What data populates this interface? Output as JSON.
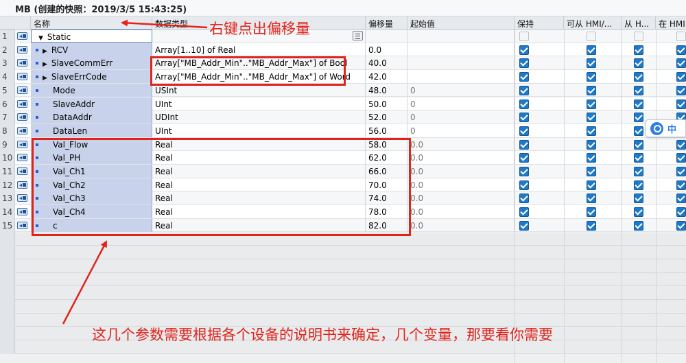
{
  "window": {
    "title": "MB (创建的快照：2019/3/5 15:43:25)"
  },
  "columns": {
    "name": "名称",
    "datatype": "数据类型",
    "offset": "偏移量",
    "start": "起始值",
    "retain": "保持",
    "hmi_access": "可从 HMI/...",
    "hmi_from": "从 H...",
    "hmi_in": "在 HMI"
  },
  "rows": [
    {
      "num": "1",
      "name": "Static",
      "datatype": "",
      "offset": "",
      "start": "",
      "expand": "▼",
      "level": 0,
      "checks": [
        false,
        false,
        false,
        false
      ]
    },
    {
      "num": "2",
      "name": "RCV",
      "datatype": "Array[1..10] of Real",
      "offset": "0.0",
      "start": "",
      "expand": "▶",
      "level": 1,
      "checks": [
        true,
        true,
        true,
        true
      ]
    },
    {
      "num": "3",
      "name": "SlaveCommErr",
      "datatype": "Array[\"MB_Addr_Min\"..\"MB_Addr_Max\"] of Bool",
      "offset": "40.0",
      "start": "",
      "expand": "▶",
      "level": 1,
      "checks": [
        true,
        true,
        true,
        true
      ]
    },
    {
      "num": "4",
      "name": "SlaveErrCode",
      "datatype": "Array[\"MB_Addr_Min\"..\"MB_Addr_Max\"] of Word",
      "offset": "42.0",
      "start": "",
      "expand": "▶",
      "level": 1,
      "checks": [
        true,
        true,
        true,
        true
      ]
    },
    {
      "num": "5",
      "name": "Mode",
      "datatype": "USInt",
      "offset": "48.0",
      "start": "0",
      "expand": "",
      "level": 1,
      "checks": [
        true,
        true,
        true,
        true
      ]
    },
    {
      "num": "6",
      "name": "SlaveAddr",
      "datatype": "UInt",
      "offset": "50.0",
      "start": "0",
      "expand": "",
      "level": 1,
      "checks": [
        true,
        true,
        true,
        true
      ]
    },
    {
      "num": "7",
      "name": "DataAddr",
      "datatype": "UDInt",
      "offset": "52.0",
      "start": "0",
      "expand": "",
      "level": 1,
      "checks": [
        true,
        true,
        true,
        true
      ]
    },
    {
      "num": "8",
      "name": "DataLen",
      "datatype": "UInt",
      "offset": "56.0",
      "start": "0",
      "expand": "",
      "level": 1,
      "checks": [
        true,
        true,
        true,
        true
      ]
    },
    {
      "num": "9",
      "name": "Val_Flow",
      "datatype": "Real",
      "offset": "58.0",
      "start": "0.0",
      "expand": "",
      "level": 1,
      "checks": [
        true,
        true,
        true,
        true
      ]
    },
    {
      "num": "10",
      "name": "Val_PH",
      "datatype": "Real",
      "offset": "62.0",
      "start": "0.0",
      "expand": "",
      "level": 1,
      "checks": [
        true,
        true,
        true,
        true
      ]
    },
    {
      "num": "11",
      "name": "Val_Ch1",
      "datatype": "Real",
      "offset": "66.0",
      "start": "0.0",
      "expand": "",
      "level": 1,
      "checks": [
        true,
        true,
        true,
        true
      ]
    },
    {
      "num": "12",
      "name": "Val_Ch2",
      "datatype": "Real",
      "offset": "70.0",
      "start": "0.0",
      "expand": "",
      "level": 1,
      "checks": [
        true,
        true,
        true,
        true
      ]
    },
    {
      "num": "13",
      "name": "Val_Ch3",
      "datatype": "Real",
      "offset": "74.0",
      "start": "0.0",
      "expand": "",
      "level": 1,
      "checks": [
        true,
        true,
        true,
        true
      ]
    },
    {
      "num": "14",
      "name": "Val_Ch4",
      "datatype": "Real",
      "offset": "78.0",
      "start": "0.0",
      "expand": "",
      "level": 1,
      "checks": [
        true,
        true,
        true,
        true
      ]
    },
    {
      "num": "15",
      "name": "c",
      "datatype": "Real",
      "offset": "82.0",
      "start": "0.0",
      "expand": "",
      "level": 1,
      "checks": [
        true,
        true,
        true,
        true
      ]
    }
  ],
  "annotations": {
    "top": "右键点出偏移量",
    "bottom": "这几个参数需要根据各个设备的说明书来确定，几个变量，那要看你需要"
  },
  "widget": {
    "label": "中"
  },
  "colors": {
    "annotation": "#e2231a",
    "checkbox": "#1f79c8",
    "name_column": "#c8d2ea"
  }
}
